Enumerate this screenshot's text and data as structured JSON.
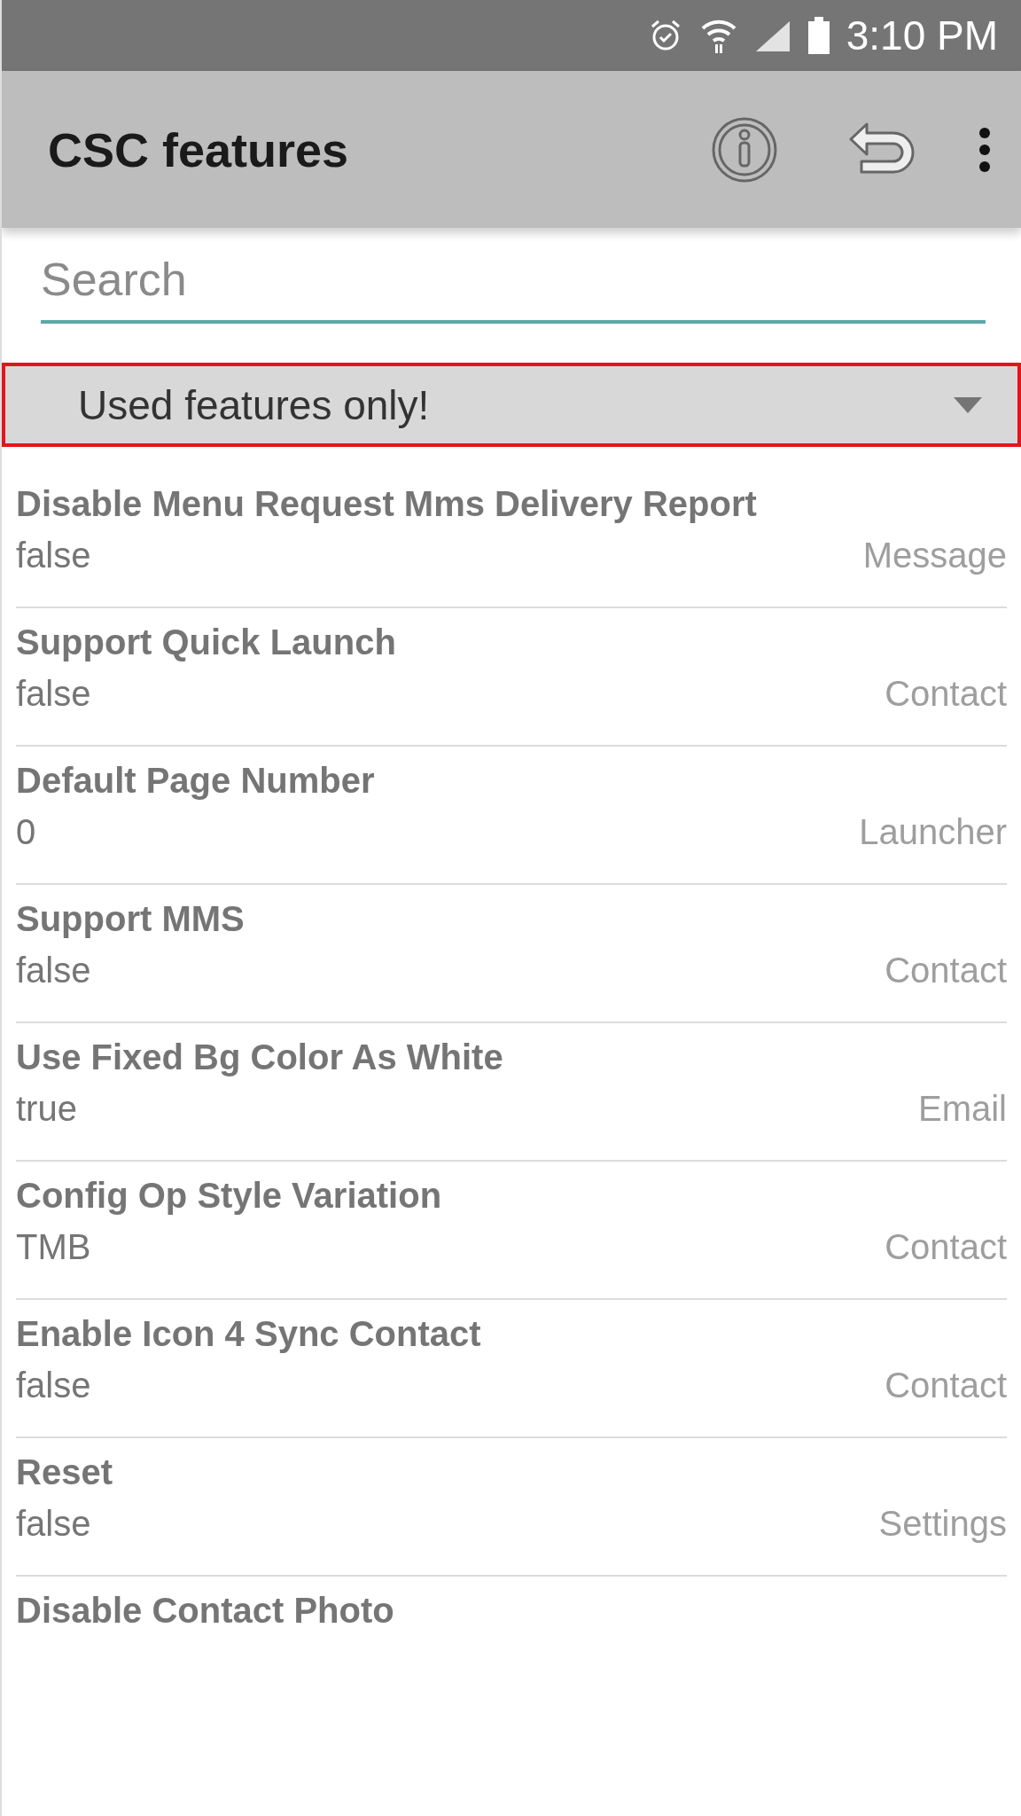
{
  "status_bar": {
    "time": "3:10 PM"
  },
  "app_bar": {
    "title": "CSC features"
  },
  "search": {
    "placeholder": "Search"
  },
  "filter_dropdown": {
    "value": "Used features only!"
  },
  "features": [
    {
      "name": "Disable Menu Request Mms Delivery Report",
      "value": "false",
      "category": "Message"
    },
    {
      "name": "Support Quick Launch",
      "value": "false",
      "category": "Contact"
    },
    {
      "name": "Default Page Number",
      "value": "0",
      "category": "Launcher"
    },
    {
      "name": "Support MMS",
      "value": "false",
      "category": "Contact"
    },
    {
      "name": "Use Fixed Bg Color As White",
      "value": "true",
      "category": "Email"
    },
    {
      "name": "Config Op Style Variation",
      "value": "TMB",
      "category": "Contact"
    },
    {
      "name": "Enable Icon 4 Sync Contact",
      "value": "false",
      "category": "Contact"
    },
    {
      "name": "Reset",
      "value": "false",
      "category": "Settings"
    },
    {
      "name": "Disable Contact Photo"
    }
  ]
}
